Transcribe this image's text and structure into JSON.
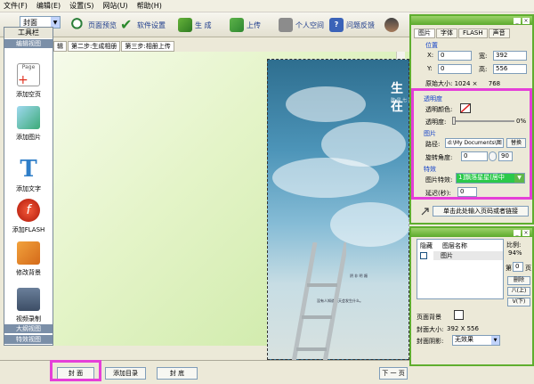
{
  "menu": {
    "file": "文件(F)",
    "edit": "编辑(E)",
    "settings": "设置(S)",
    "site": "网站(U)",
    "help": "帮助(H)"
  },
  "toolbar": {
    "zoom_value": "封面",
    "preview": "页面预览",
    "settings": "软件设置",
    "generate": "生 成",
    "upload": "上传",
    "space": "个人空间",
    "feedback": "问题反馈"
  },
  "left_panel": {
    "title": "工具栏",
    "tab_edit": "编辑视图",
    "items": [
      "添加空页",
      "添加图片",
      "添加文字",
      "添加FLASH",
      "修改背景",
      "视频录制"
    ],
    "page_thumb": "Page",
    "tab_outline": "大纲视图",
    "tab_effect": "特效视图"
  },
  "step_tabs": [
    "辑",
    "第二步:生成相册",
    "第三步:相册上传"
  ],
  "page_art": {
    "title": "生在",
    "subtitle": "敢 是 七 月",
    "caption": "没有人知道明天会发生什么。",
    "side_text": "阴 非 明 媚"
  },
  "bottom": {
    "cover": "封  面",
    "add_toc": "添加目录",
    "back_cover": "封  底",
    "next": "下 一 页"
  },
  "props": {
    "tabs": [
      "图片",
      "字体",
      "FLASH",
      "声音"
    ],
    "position_title": "位置",
    "x_label": "X:",
    "x_value": "0",
    "w_label": "宽:",
    "w_value": "392",
    "y_label": "Y:",
    "y_value": "0",
    "h_label": "高:",
    "h_value": "556",
    "orig_size_label": "原始大小:",
    "orig_w": "1024",
    "orig_x": "×",
    "orig_h": "768",
    "transparency_title": "透明度",
    "trans_color_label": "透明颜色:",
    "trans_label": "透明度:",
    "trans_value": "0%",
    "image_title": "图片",
    "path_label": "路径:",
    "path_value": "d:\\My Documents\\图",
    "replace": "替换",
    "rotate_label": "旋转角度:",
    "rotate_value": "0",
    "rotate_max": "90",
    "effect_title": "特效",
    "effect_label": "图片特效:",
    "effect_value": "1]飘落星星(居中",
    "delay_label": "延迟(秒):",
    "delay_value": "0",
    "link_button": "单击此处输入页码或者链接"
  },
  "layers": {
    "col_hide": "隐藏",
    "col_name": "图层名称",
    "rows": [
      "图片"
    ],
    "ratio_label": "比例:",
    "ratio_value": "94%",
    "page_prefix": "第",
    "page_value": "0",
    "page_suffix": "页",
    "delete": "删除",
    "up": "八(上)",
    "down": "V(下)",
    "bg_label": "页面背景",
    "cover_size_label": "封面大小:",
    "cover_size_value": "392 X 556",
    "shadow_label": "封面阴影:",
    "shadow_value": "无效果"
  },
  "colors": {
    "accent_green": "#5FAE2F",
    "highlight": "#E53FD8"
  }
}
